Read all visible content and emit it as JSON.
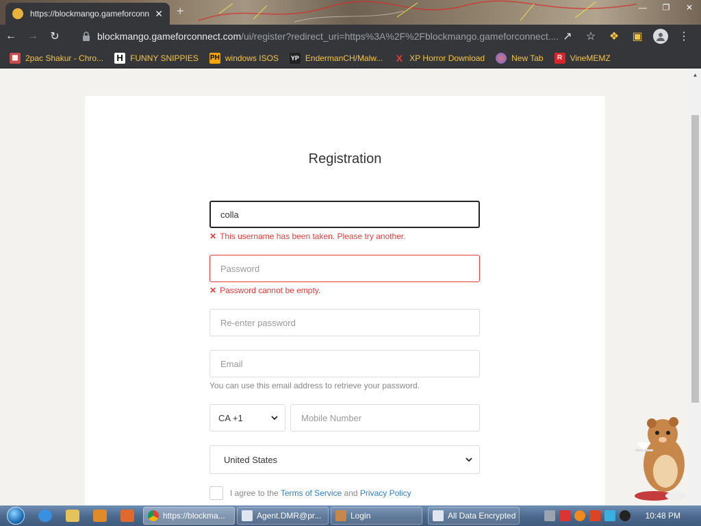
{
  "browser": {
    "tab_title": "https://blockmango.gameforconnect",
    "url_host": "blockmango.gameforconnect.com",
    "url_path": "/ui/register?redirect_uri=https%3A%2F%2Fblockmango.gameforconnect....",
    "tab_close": "✕",
    "new_tab": "+"
  },
  "bookmarks": [
    {
      "label": "2pac Shakur - Chro...",
      "icon": "bookmark-icon"
    },
    {
      "label": "FUNNY SNIPPIES",
      "icon": "H"
    },
    {
      "label": "windows ISOS",
      "icon": "PH"
    },
    {
      "label": "EndermanCH/Malw...",
      "icon": "YP"
    },
    {
      "label": "XP Horror Download",
      "icon": "X"
    },
    {
      "label": "New Tab",
      "icon": "globe-icon"
    },
    {
      "label": "VineMEMZ",
      "icon": "R"
    }
  ],
  "form": {
    "title": "Registration",
    "username_value": "colla",
    "username_error": "This username has been taken. Please try another.",
    "password_placeholder": "Password",
    "password_error": "Password cannot be empty.",
    "reenter_placeholder": "Re-enter password",
    "email_placeholder": "Email",
    "email_hint": "You can use this email address to retrieve your password.",
    "country_code": "CA +1",
    "mobile_placeholder": "Mobile Number",
    "country": "United States",
    "agree_prefix": "I agree to the",
    "terms_label": "Terms of Service",
    "agree_and": "and",
    "privacy_label": "Privacy Policy",
    "error_glyph": "✕"
  },
  "taskbar": {
    "tasks": [
      {
        "label": "https://blockma...",
        "active": true
      },
      {
        "label": "Agent.DMR@pr...",
        "active": false
      },
      {
        "label": "Login",
        "active": false
      },
      {
        "label": "All Data Encrypted",
        "active": false
      }
    ],
    "time": "10:48 PM"
  },
  "colors": {
    "error": "#e23c3c",
    "link": "#2a7fd4",
    "chrome_dark": "#35363a",
    "bookmark_text": "#f5c542"
  }
}
